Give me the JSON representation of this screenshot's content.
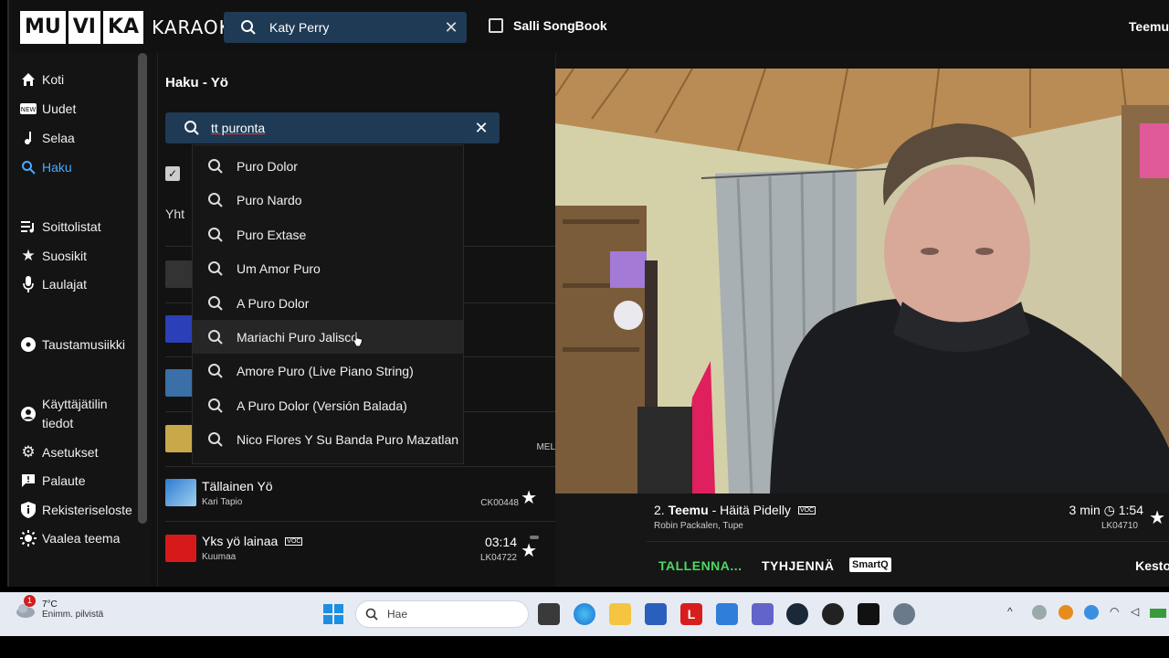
{
  "header": {
    "logo_parts": [
      "MU",
      "VI",
      "KA"
    ],
    "logo_word": "KARAOKE",
    "search_value": "Katy Perry",
    "songbook_label": "Salli SongBook",
    "username": "Teemu"
  },
  "sidebar": {
    "items": [
      {
        "label": "Koti",
        "icon": "home-icon"
      },
      {
        "label": "Uudet",
        "icon": "new-badge-icon"
      },
      {
        "label": "Selaa",
        "icon": "music-note-icon"
      },
      {
        "label": "Haku",
        "icon": "search-icon",
        "active": true
      },
      {
        "label": "Soittolistat",
        "icon": "playlist-icon"
      },
      {
        "label": "Suosikit",
        "icon": "star-icon"
      },
      {
        "label": "Laulajat",
        "icon": "microphone-icon"
      },
      {
        "label": "Taustamusiikki",
        "icon": "disc-icon"
      },
      {
        "label": "Käyttäjätilin tiedot",
        "icon": "account-icon"
      },
      {
        "label": "Asetukset",
        "icon": "gear-icon"
      },
      {
        "label": "Palaute",
        "icon": "feedback-icon"
      },
      {
        "label": "Rekisteriseloste",
        "icon": "info-icon"
      },
      {
        "label": "Vaalea teema",
        "icon": "sun-icon"
      }
    ]
  },
  "search_panel": {
    "title": "Haku - Yö",
    "query": "tt puronta",
    "results_label": "Yht",
    "suggestions": [
      "Puro Dolor",
      "Puro Nardo",
      "Puro Extase",
      "Um Amor Puro",
      "A Puro Dolor",
      "Mariachi Puro Jalisco",
      "Amore Puro (Live Piano String)",
      "A Puro Dolor (Versión Balada)",
      "Nico Flores Y Su Banda Puro Mazatlan"
    ],
    "partial_code": "MEL",
    "rows": [
      {
        "title": "Tällainen Yö",
        "artist": "Kari Tapio",
        "time": "",
        "code": "CK00448"
      },
      {
        "title": "Yks yö lainaa",
        "artist": "Kuumaa",
        "time": "03:14",
        "code": "LK04722",
        "voc": "VOC"
      }
    ]
  },
  "now_playing": {
    "position": "2.",
    "singer": "Teemu",
    "song": "- Häitä Pidelly",
    "voc": "VOC",
    "artists": "Robin Packalen, Tupe",
    "duration": "3 min",
    "countdown": "1:54",
    "code": "LK04710",
    "save_label": "TALLENNA...",
    "clear_label": "TYHJENNÄ",
    "smartq_label": "SmartQ",
    "duration_label": "Kesto"
  },
  "taskbar": {
    "weather_temp": "7°C",
    "weather_desc": "Enimm. pilvistä",
    "weather_badge": "1",
    "search_placeholder": "Hae"
  },
  "colors": {
    "accent_blue": "#4aa8ff",
    "search_bg": "#1f3a55",
    "save_green": "#4cd964"
  }
}
